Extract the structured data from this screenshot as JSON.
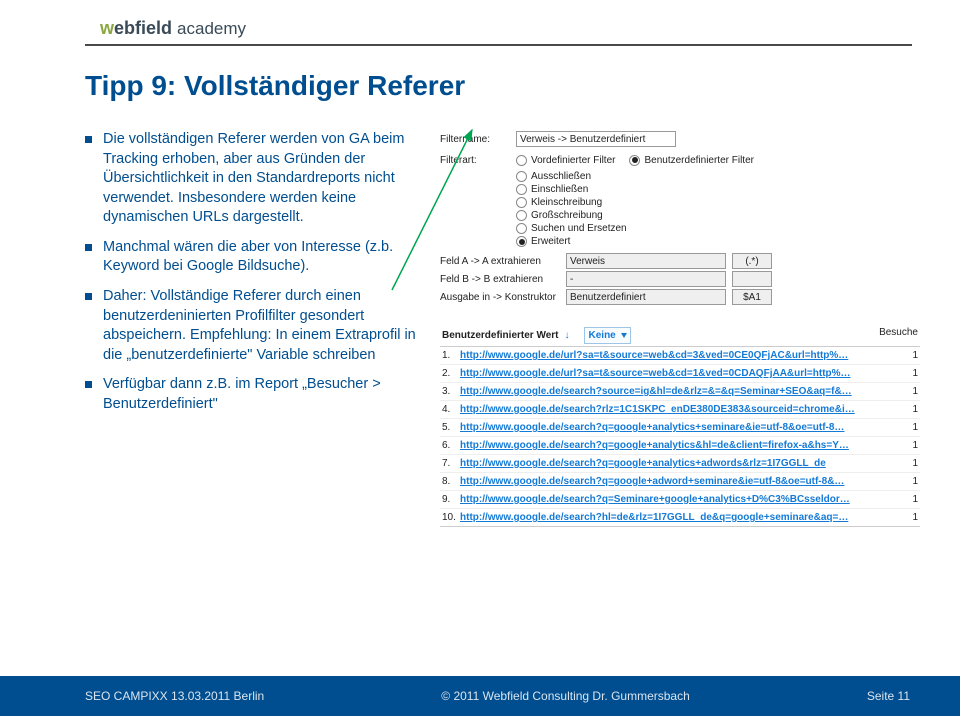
{
  "brand": {
    "part1": "w",
    "part2": "ebfield ",
    "part3": "academy"
  },
  "title": "Tipp 9: Vollständiger Referer",
  "bullets": [
    "Die vollständigen Referer werden von GA beim Tracking erhoben, aber aus Gründen der Übersichtlichkeit in den Standardreports nicht verwendet. Insbesondere werden keine dynamischen URLs dargestellt.",
    "Manchmal wären die aber von Interesse (z.b. Keyword bei Google Bildsuche).",
    "Daher: Vollständige Referer durch einen benutzerdeninierten Profilfilter gesondert abspeichern. Empfehlung: In einem Extraprofil in die „benutzerdefinierte\" Variable schreiben",
    "Verfügbar dann z.B. im Report „Besucher > Benutzerdefiniert\""
  ],
  "form": {
    "filtername_label": "Filtername:",
    "filtername_value": "Verweis -> Benutzerdefiniert",
    "filterart_label": "Filterart:",
    "art_options": [
      {
        "label": "Vordefinierter Filter",
        "checked": false
      },
      {
        "label": "Benutzerdefinierter Filter",
        "checked": true
      }
    ],
    "type_options": [
      {
        "label": "Ausschließen",
        "checked": false
      },
      {
        "label": "Einschließen",
        "checked": false
      },
      {
        "label": "Kleinschreibung",
        "checked": false
      },
      {
        "label": "Großschreibung",
        "checked": false
      },
      {
        "label": "Suchen und Ersetzen",
        "checked": false
      },
      {
        "label": "Erweitert",
        "checked": true
      }
    ],
    "rows": [
      {
        "label": "Feld A -> A extrahieren",
        "select": "Verweis",
        "extra": "(.*)"
      },
      {
        "label": "Feld B -> B extrahieren",
        "select": "-",
        "extra": ""
      },
      {
        "label": "Ausgabe in -> Konstruktor",
        "select": "Benutzerdefiniert",
        "extra": "$A1"
      }
    ]
  },
  "table": {
    "header_left": "Benutzerdefinierter Wert",
    "header_none": "Keine",
    "header_right": "Besuche",
    "rows": [
      {
        "n": "1.",
        "url": "http://www.google.de/url?sa=t&source=web&cd=3&ved=0CE0QFjAC&url=http%…",
        "v": "1"
      },
      {
        "n": "2.",
        "url": "http://www.google.de/url?sa=t&source=web&cd=1&ved=0CDAQFjAA&url=http%…",
        "v": "1"
      },
      {
        "n": "3.",
        "url": "http://www.google.de/search?source=ig&hl=de&rlz=&=&q=Seminar+SEO&aq=f&…",
        "v": "1"
      },
      {
        "n": "4.",
        "url": "http://www.google.de/search?rlz=1C1SKPC_enDE380DE383&sourceid=chrome&i…",
        "v": "1"
      },
      {
        "n": "5.",
        "url": "http://www.google.de/search?q=google+analytics+seminare&ie=utf-8&oe=utf-8…",
        "v": "1"
      },
      {
        "n": "6.",
        "url": "http://www.google.de/search?q=google+analytics&hl=de&client=firefox-a&hs=Y…",
        "v": "1"
      },
      {
        "n": "7.",
        "url": "http://www.google.de/search?q=google+analytics+adwords&rlz=1I7GGLL_de",
        "v": "1"
      },
      {
        "n": "8.",
        "url": "http://www.google.de/search?q=google+adword+seminare&ie=utf-8&oe=utf-8&…",
        "v": "1"
      },
      {
        "n": "9.",
        "url": "http://www.google.de/search?q=Seminare+google+analytics+D%C3%BCsseldor…",
        "v": "1"
      },
      {
        "n": "10.",
        "url": "http://www.google.de/search?hl=de&rlz=1I7GGLL_de&q=google+seminare&aq=…",
        "v": "1"
      }
    ]
  },
  "footer": {
    "left": "SEO CAMPIXX 13.03.2011 Berlin",
    "mid": "© 2011 Webfield Consulting Dr. Gummersbach",
    "right": "Seite 11"
  }
}
